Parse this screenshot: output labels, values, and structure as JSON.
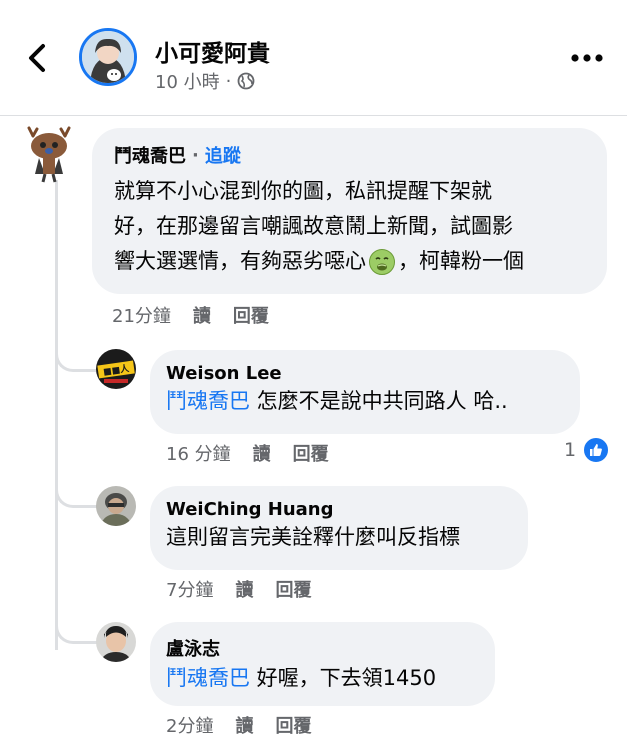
{
  "header": {
    "page_name": "小可愛阿貴",
    "post_time": "10 小時",
    "meta_separator": "·",
    "privacy_icon": "globe-icon",
    "back_icon": "chevron-left-icon",
    "more_icon": "more-horizontal-icon"
  },
  "comments": [
    {
      "author": "鬥魂喬巴",
      "follow_label": "追蹤",
      "separator": "·",
      "text_lines": [
        "就算不小心混到你的圖，私訊提醒下架就",
        "好，在那邊留言嘲諷故意鬧上新聞，試圖影"
      ],
      "text_line3_before": "響大選選情，有夠惡劣噁心",
      "emoji": "nauseated-face-icon",
      "text_line3_after": "，柯韓粉一個",
      "time": "21分鐘",
      "like_label": "讀",
      "reply_label": "回覆"
    }
  ],
  "replies": [
    {
      "author": "Weison Lee",
      "mention": "鬥魂喬巴",
      "text": " 怎麼不是說中共同路人 哈..",
      "time": "16 分鐘",
      "like_label": "讀",
      "reply_label": "回覆",
      "reaction_count": "1",
      "reaction_icon": "like-icon"
    },
    {
      "author": "WeiChing Huang",
      "mention": "",
      "text": "這則留言完美詮釋什麼叫反指標",
      "time": "7分鐘",
      "like_label": "讀",
      "reply_label": "回覆"
    },
    {
      "author": "盧泳志",
      "mention": "鬥魂喬巴",
      "text": " 好喔，下去領1450",
      "time": "2分鐘",
      "like_label": "讀",
      "reply_label": "回覆"
    }
  ],
  "colors": {
    "accent": "#1877f2",
    "bubble_bg": "#f0f2f5",
    "secondary_text": "#65676b",
    "divider": "#dddfe2"
  }
}
